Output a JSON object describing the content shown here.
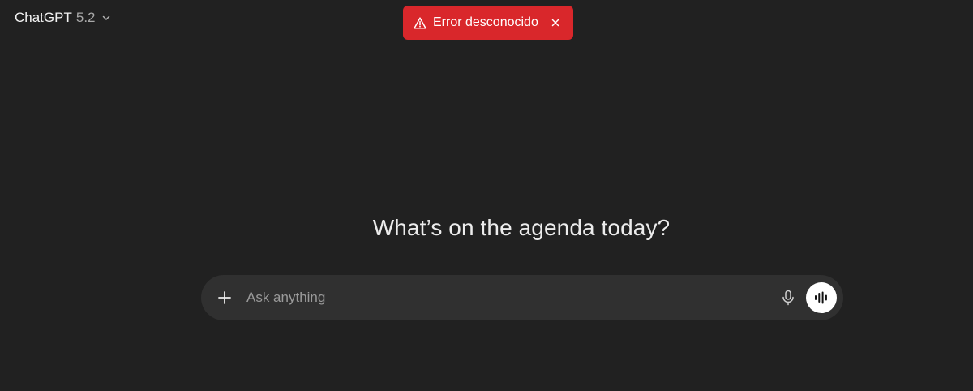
{
  "header": {
    "model_name": "ChatGPT",
    "model_version": "5.2",
    "dropdown_icon": "chevron-down-icon"
  },
  "toast": {
    "message": "Error desconocido",
    "icon": "warning-triangle-icon",
    "close_icon": "close-icon",
    "background_color": "#d9272b"
  },
  "main": {
    "headline": "What’s on the agenda today?"
  },
  "composer": {
    "placeholder": "Ask anything",
    "value": "",
    "add_icon": "plus-icon",
    "mic_icon": "microphone-icon",
    "voice_icon": "voice-waveform-icon"
  },
  "theme": {
    "background": "#212121",
    "composer_background": "#303030",
    "text": "#ececec"
  }
}
